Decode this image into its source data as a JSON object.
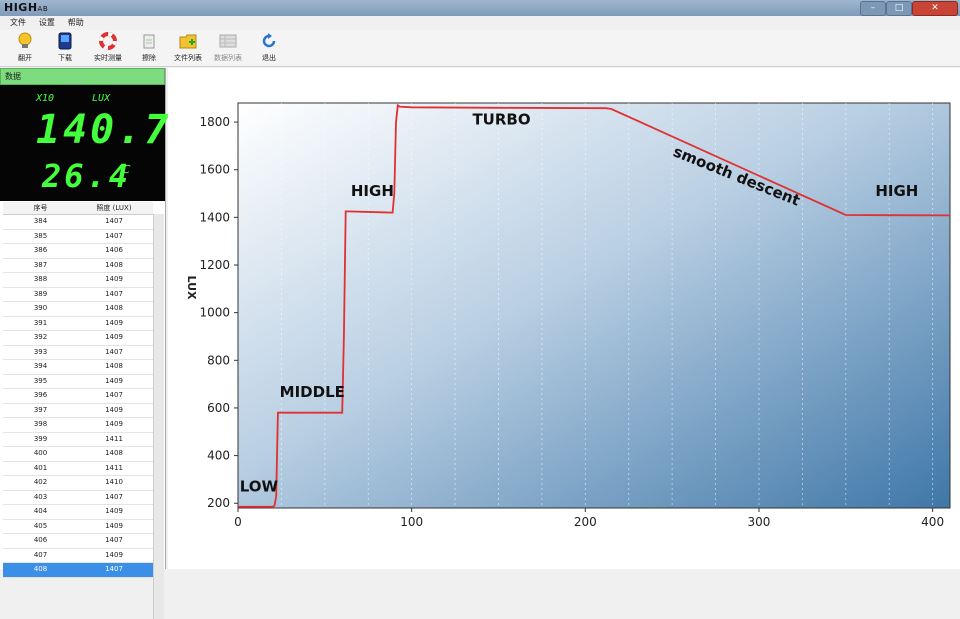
{
  "app": {
    "logo": "HIGHLAB",
    "logo_main": "HIGH",
    "logo_sub": "AB"
  },
  "menu": [
    "文件",
    "设置",
    "帮助"
  ],
  "toolbar": {
    "buttons": [
      {
        "label": "翻开",
        "icon": "bulb-icon"
      },
      {
        "label": "下载",
        "icon": "device-icon"
      },
      {
        "label": "实时测量",
        "icon": "lifebuoy-icon"
      },
      {
        "label": "擦除",
        "icon": "erase-icon"
      },
      {
        "label": "文件列表",
        "icon": "folder-add-icon"
      },
      {
        "label": "数据列表",
        "icon": "data-list-icon"
      },
      {
        "label": "退出",
        "icon": "refresh-icon"
      }
    ]
  },
  "left": {
    "header": "数据",
    "display": {
      "multiplier": "X10",
      "unit": "LUX",
      "lux_value": "140.7",
      "temp_value": "26.4",
      "temp_unit": "℃"
    },
    "table": {
      "columns": [
        "序号",
        "照度 (LUX)"
      ],
      "rows": [
        [
          "384",
          "1407"
        ],
        [
          "385",
          "1407"
        ],
        [
          "386",
          "1406"
        ],
        [
          "387",
          "1408"
        ],
        [
          "388",
          "1409"
        ],
        [
          "389",
          "1407"
        ],
        [
          "390",
          "1408"
        ],
        [
          "391",
          "1409"
        ],
        [
          "392",
          "1409"
        ],
        [
          "393",
          "1407"
        ],
        [
          "394",
          "1408"
        ],
        [
          "395",
          "1409"
        ],
        [
          "396",
          "1407"
        ],
        [
          "397",
          "1409"
        ],
        [
          "398",
          "1409"
        ],
        [
          "399",
          "1411"
        ],
        [
          "400",
          "1408"
        ],
        [
          "401",
          "1411"
        ],
        [
          "402",
          "1410"
        ],
        [
          "403",
          "1407"
        ],
        [
          "404",
          "1409"
        ],
        [
          "405",
          "1409"
        ],
        [
          "406",
          "1407"
        ],
        [
          "407",
          "1409"
        ],
        [
          "408",
          "1407"
        ]
      ],
      "selected_index": 24
    }
  },
  "chart_data": {
    "type": "line",
    "ylabel": "LUX",
    "xlim": [
      0,
      410
    ],
    "ylim": [
      180,
      1880
    ],
    "xticks": [
      0,
      100,
      200,
      300,
      400
    ],
    "yticks": [
      200,
      400,
      600,
      800,
      1000,
      1200,
      1400,
      1600,
      1800
    ],
    "series": [
      {
        "color": "#e03030",
        "x": [
          0,
          20,
          21,
          22,
          23,
          60,
          61,
          62,
          63,
          89,
          90,
          91,
          92,
          93,
          100,
          150,
          212,
          215,
          350,
          410
        ],
        "y": [
          185,
          185,
          190,
          230,
          580,
          580,
          900,
          1425,
          1425,
          1420,
          1500,
          1800,
          1870,
          1865,
          1862,
          1860,
          1858,
          1855,
          1410,
          1408
        ]
      }
    ],
    "annotations": [
      {
        "text": "LOW",
        "x": 1,
        "y": 250,
        "rotate": 0
      },
      {
        "text": "MIDDLE",
        "x": 24,
        "y": 645,
        "rotate": 0
      },
      {
        "text": "HIGH",
        "x": 65,
        "y": 1490,
        "rotate": 0
      },
      {
        "text": "TURBO",
        "x": 135,
        "y": 1790,
        "rotate": 0
      },
      {
        "text": "smooth descent",
        "x": 250,
        "y": 1660,
        "rotate": 22
      },
      {
        "text": "HIGH",
        "x": 367,
        "y": 1490,
        "rotate": 0
      }
    ],
    "grid": true
  }
}
